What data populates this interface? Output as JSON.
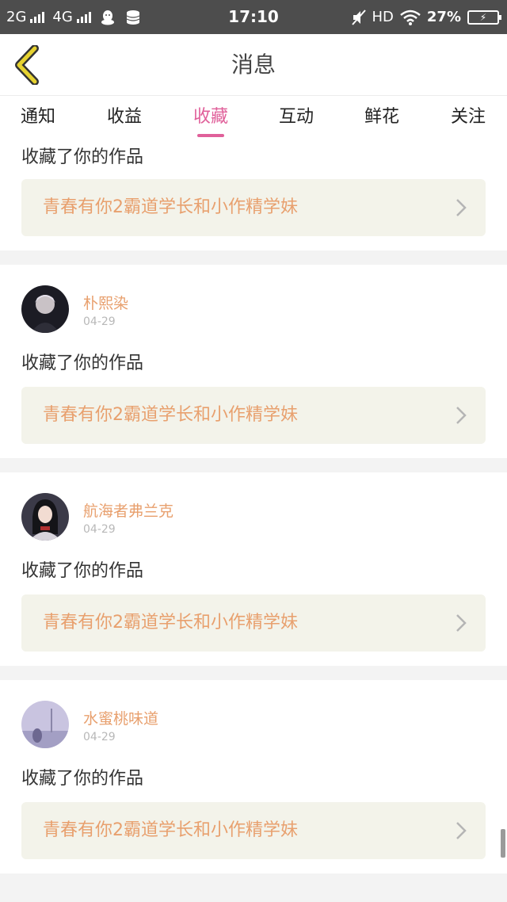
{
  "status_bar": {
    "net1": "2G",
    "net2": "4G",
    "time": "17:10",
    "hd": "HD",
    "battery": "27%"
  },
  "header": {
    "title": "消息"
  },
  "tabs": [
    {
      "label": "通知"
    },
    {
      "label": "收益"
    },
    {
      "label": "收藏",
      "active": true
    },
    {
      "label": "互动"
    },
    {
      "label": "鲜花"
    },
    {
      "label": "关注"
    }
  ],
  "items": [
    {
      "action": "收藏了你的作品",
      "work_title": "青春有你2霸道学长和小作精学妹"
    },
    {
      "user": "朴熙染",
      "date": "04-29",
      "action": "收藏了你的作品",
      "work_title": "青春有你2霸道学长和小作精学妹"
    },
    {
      "user": "航海者弗兰克",
      "date": "04-29",
      "action": "收藏了你的作品",
      "work_title": "青春有你2霸道学长和小作精学妹"
    },
    {
      "user": "水蜜桃味道",
      "date": "04-29",
      "action": "收藏了你的作品",
      "work_title": "青春有你2霸道学长和小作精学妹"
    }
  ],
  "colors": {
    "accent": "#e0609a",
    "name_orange": "#e8a06e",
    "back_icon": "#e6d230"
  }
}
